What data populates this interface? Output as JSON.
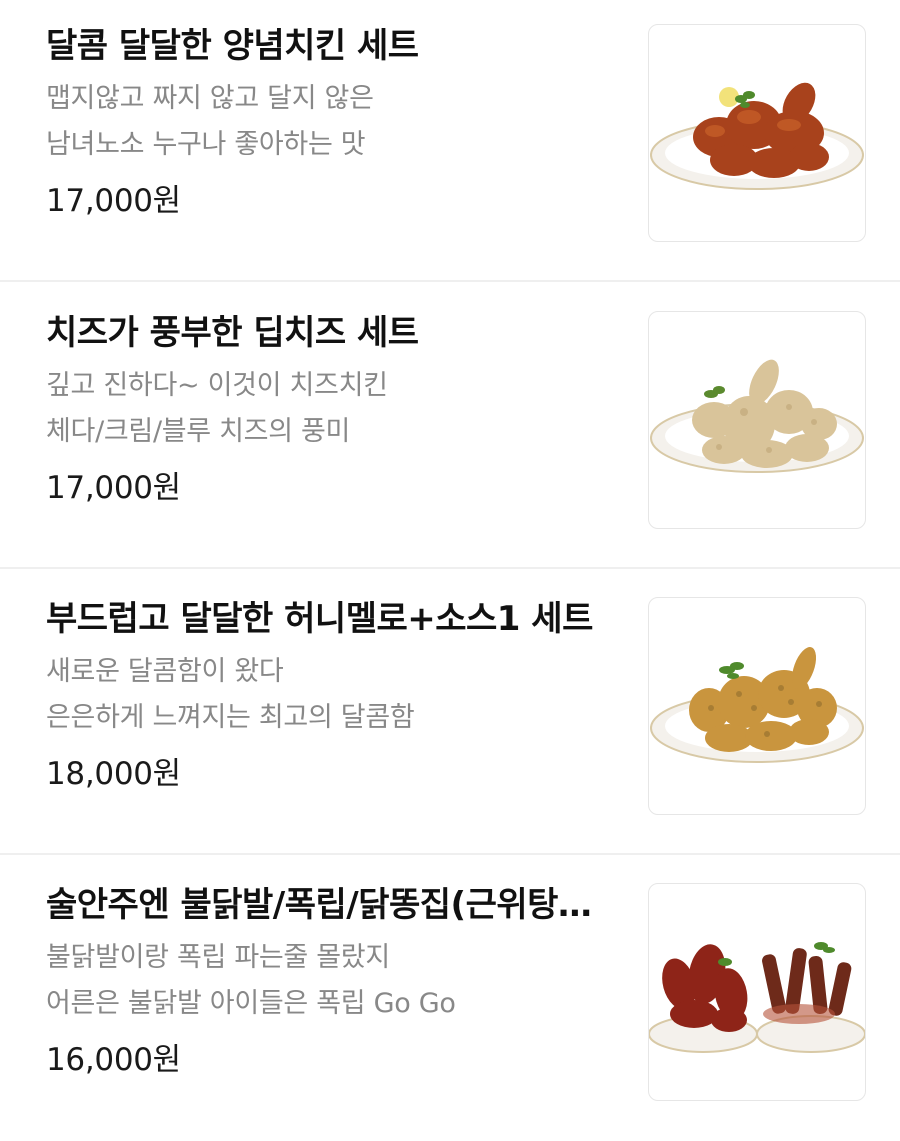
{
  "menu": {
    "items": [
      {
        "name": "달콤 달달한 양념치킨 세트",
        "desc1": "맵지않고 짜지 않고 달지 않은",
        "desc2": "남녀노소 누구나 좋아하는 맛",
        "price": "17,000원",
        "image_icon": "seasoned-chicken-plate",
        "food_color": "#a8421c"
      },
      {
        "name": "치즈가 풍부한 딥치즈 세트",
        "desc1": "깊고 진하다~ 이것이 치즈치킨",
        "desc2": "체다/크림/블루 치즈의 풍미",
        "price": "17,000원",
        "image_icon": "cheese-chicken-plate",
        "food_color": "#d9c49a"
      },
      {
        "name": "부드럽고 달달한 허니멜로+소스1 세트",
        "desc1": "새로운 달콤함이 왔다",
        "desc2": "은은하게 느껴지는 최고의 달콤함",
        "price": "18,000원",
        "image_icon": "honey-chicken-plate",
        "food_color": "#c9953e"
      },
      {
        "name": "술안주엔 불닭발/폭립/닭똥집(근위탕…",
        "desc1": "불닭발이랑 폭립 파는줄 몰랐지",
        "desc2": "어른은 불닭발 아이들은 폭립 Go Go",
        "price": "16,000원",
        "image_icon": "spicy-feet-ribs-plates",
        "food_color": "#8e2418"
      }
    ]
  }
}
